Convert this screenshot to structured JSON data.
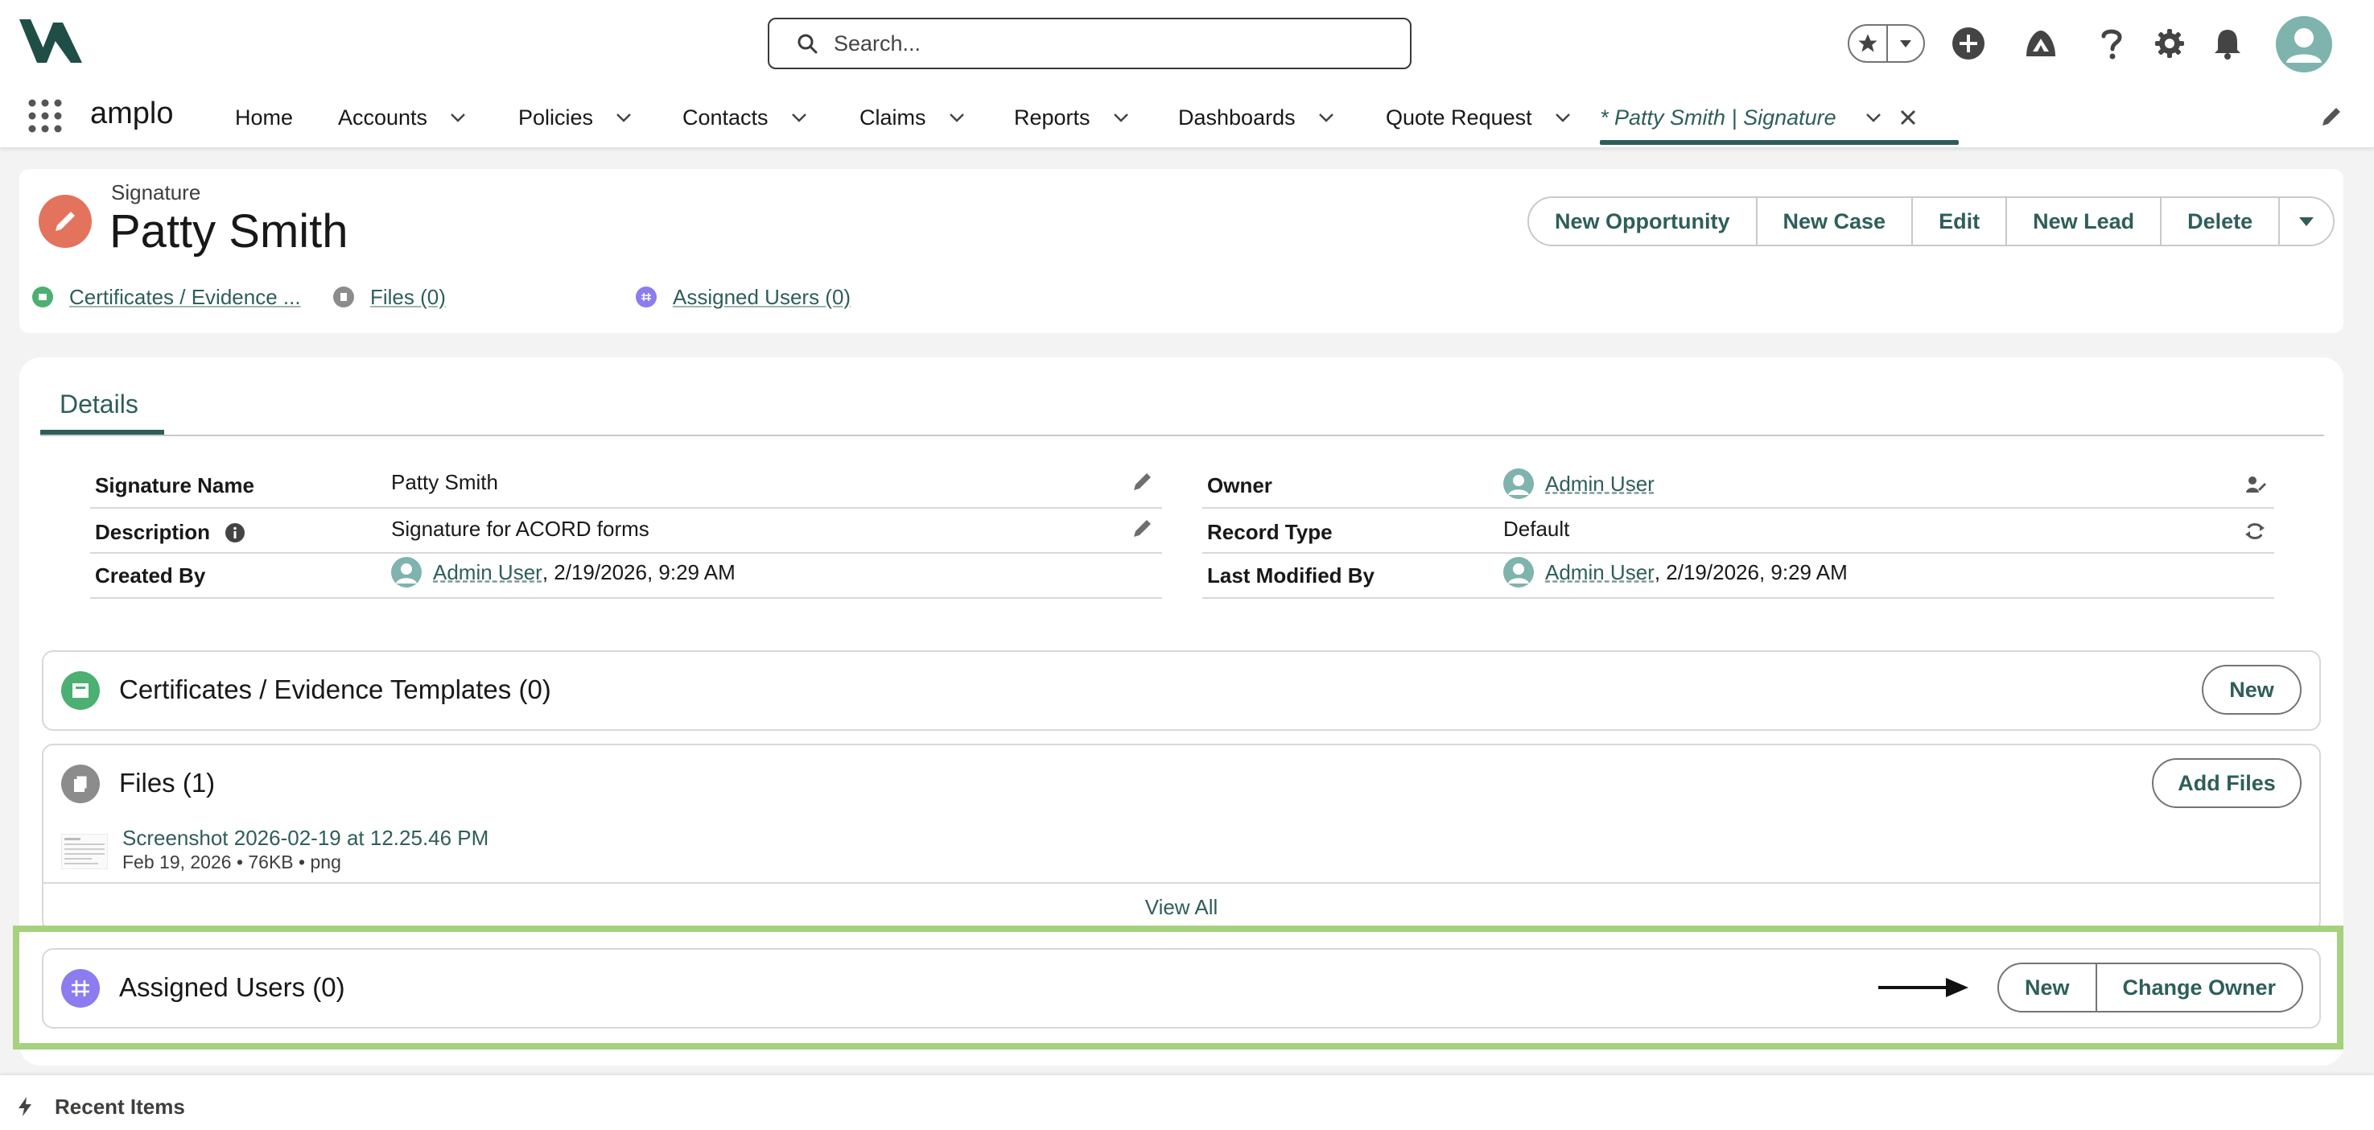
{
  "header": {
    "search_placeholder": "Search...",
    "app_name": "amplo"
  },
  "nav": {
    "items": [
      {
        "label": "Home",
        "has_menu": false
      },
      {
        "label": "Accounts",
        "has_menu": true
      },
      {
        "label": "Policies",
        "has_menu": true
      },
      {
        "label": "Contacts",
        "has_menu": true
      },
      {
        "label": "Claims",
        "has_menu": true
      },
      {
        "label": "Reports",
        "has_menu": true
      },
      {
        "label": "Dashboards",
        "has_menu": true
      },
      {
        "label": "Quote Request",
        "has_menu": true
      }
    ],
    "active_tab": "* Patty Smith | Signature"
  },
  "record": {
    "type": "Signature",
    "title": "Patty Smith",
    "actions": [
      "New Opportunity",
      "New Case",
      "Edit",
      "New Lead",
      "Delete"
    ],
    "related_links": [
      {
        "label": "Certificates / Evidence ...",
        "icon": "certificate-icon"
      },
      {
        "label": "Files (0)",
        "icon": "files-icon"
      },
      {
        "label": "Assigned Users (0)",
        "icon": "assigned-users-icon"
      }
    ]
  },
  "details": {
    "tab_label": "Details",
    "fields": {
      "signature_name": {
        "label": "Signature Name",
        "value": "Patty Smith"
      },
      "description": {
        "label": "Description",
        "value": "Signature for ACORD forms"
      },
      "created_by": {
        "label": "Created By",
        "user": "Admin User",
        "date": ", 2/19/2026, 9:29 AM"
      },
      "owner": {
        "label": "Owner",
        "user": "Admin User"
      },
      "record_type": {
        "label": "Record Type",
        "value": "Default"
      },
      "last_modified_by": {
        "label": "Last Modified By",
        "user": "Admin User",
        "date": ", 2/19/2026, 9:29 AM"
      }
    }
  },
  "related": {
    "certificates": {
      "title": "Certificates / Evidence Templates (0)",
      "button": "New"
    },
    "files": {
      "title": "Files (1)",
      "button": "Add Files",
      "file_name": "Screenshot 2026-02-19 at 12.25.46 PM",
      "file_meta": "Feb 19, 2026 • 76KB • png",
      "view_all": "View All"
    },
    "assigned_users": {
      "title": "Assigned Users (0)",
      "buttons": [
        "New",
        "Change Owner"
      ]
    }
  },
  "footer": {
    "label": "Recent Items"
  },
  "colors": {
    "brand": "#2e5e5a",
    "signature_icon": "#e3735d",
    "certificate_icon": "#4bb071",
    "files_icon": "#8c8c8c",
    "assigned_users_icon": "#8b7cf0",
    "highlight": "#a6d17e"
  }
}
